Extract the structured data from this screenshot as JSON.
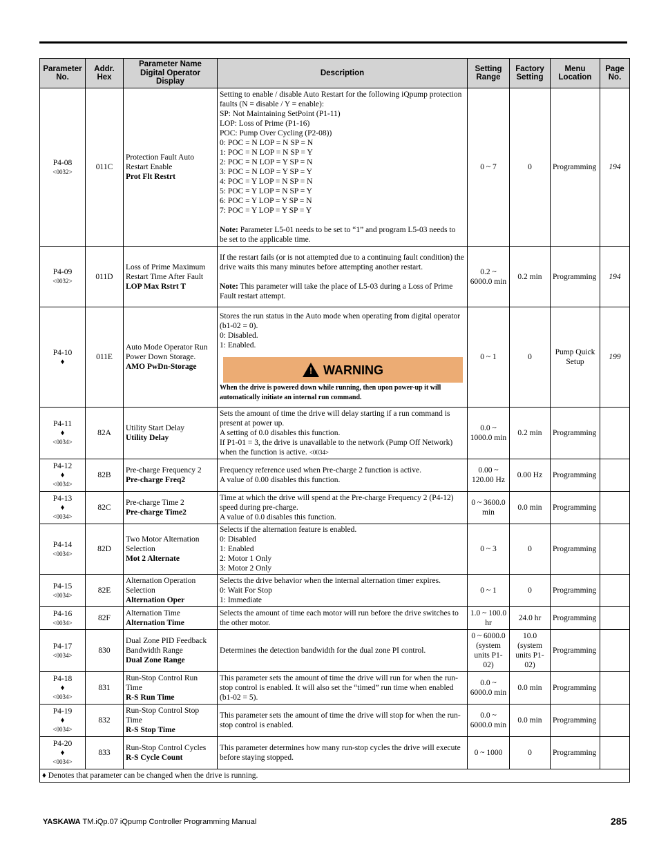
{
  "headers": {
    "param_no": "Parameter No.",
    "addr_hex": "Addr. Hex",
    "name": "Parameter Name Digital Operator Display",
    "description": "Description",
    "setting_range": "Setting Range",
    "factory_setting": "Factory Setting",
    "menu_location": "Menu Location",
    "page_no": "Page No."
  },
  "rows": [
    {
      "param": "P4-08",
      "diamond": "",
      "ref": "<0032>",
      "addr": "011C",
      "name": "Protection Fault Auto Restart Enable",
      "display": "Prot Flt Restrt",
      "desc": [
        "Setting to enable / disable Auto Restart for the following iQpump protection faults (N = disable / Y = enable):",
        "SP: Not Maintaining SetPoint (P1-11)",
        "LOP: Loss of Prime (P1-16)",
        "POC: Pump Over Cycling (P2-08))",
        "0: POC = N LOP = N SP = N",
        "1: POC = N LOP = N SP = Y",
        "2: POC = N LOP = Y SP = N",
        "3: POC = N LOP = Y SP = Y",
        "4: POC = Y LOP = N SP = N",
        "5: POC = Y LOP = N SP = Y",
        "6: POC = Y LOP = Y SP = N",
        "7: POC = Y LOP = Y SP = Y"
      ],
      "note_label": "Note:",
      "note": " Parameter L5-01 needs to be set to “1” and program L5-03 needs to be set to the applicable time.",
      "range": "0 ~ 7",
      "factory": "0",
      "menu": "Programming",
      "page": "194"
    },
    {
      "param": "P4-09",
      "diamond": "",
      "ref": "<0032>",
      "addr": "011D",
      "name": "Loss of Prime Maximum Restart Time After Fault",
      "display": "LOP Max Rstrt T",
      "desc": [
        "If the restart fails (or is not attempted due to a continuing fault condition) the drive waits this many minutes before attempting another restart."
      ],
      "note_label": "Note:",
      "note": " This parameter will take the place of L5-03 during a Loss of Prime Fault restart attempt.",
      "range": "0.2 ~ 6000.0 min",
      "factory": "0.2 min",
      "menu": "Programming",
      "page": "194"
    },
    {
      "param": "P4-10",
      "diamond": "♦",
      "ref": "",
      "addr": "011E",
      "name": "Auto Mode Operator Run Power Down Storage.",
      "display": "AMO PwDn-Storage",
      "desc": [
        "Stores the run status in the Auto mode when operating from digital operator (b1-02 = 0).",
        "0: Disabled.",
        "1: Enabled."
      ],
      "warning_label": "WARNING",
      "warning_text": "When the drive is powered down while running, then upon power-up it will automatically initiate an internal run command.",
      "range": "0 ~ 1",
      "factory": "0",
      "menu": "Pump Quick Setup",
      "page": "199"
    },
    {
      "param": "P4-11",
      "diamond": "♦",
      "ref": "<0034>",
      "addr": "82A",
      "name": "Utility Start Delay",
      "display": "Utility Delay",
      "desc": [
        "Sets the amount of time the drive will delay starting if a run command is present at power up.",
        "A setting of 0.0 disables this function.",
        "If P1-01 = 3, the drive is unavailable to the network (Pump Off Network) when the function is active."
      ],
      "desc_ref": "<0034>",
      "range": "0.0 ~ 1000.0 min",
      "factory": "0.2 min",
      "menu": "Programming",
      "page": ""
    },
    {
      "param": "P4-12",
      "diamond": "♦",
      "ref": "<0034>",
      "addr": "82B",
      "name": "Pre-charge Frequency 2",
      "display": "Pre-charge Freq2",
      "desc": [
        "Frequency reference used when Pre-charge 2 function is active.",
        "A value of 0.00 disables this function."
      ],
      "range": "0.00 ~ 120.00 Hz",
      "factory": "0.00 Hz",
      "menu": "Programming",
      "page": ""
    },
    {
      "param": "P4-13",
      "diamond": "♦",
      "ref": "<0034>",
      "addr": "82C",
      "name": "Pre-charge Time 2",
      "display": "Pre-charge Time2",
      "desc": [
        "Time at which the drive will spend at the Pre-charge Frequency 2 (P4-12) speed during pre-charge.",
        "A value of 0.0 disables this function."
      ],
      "range": "0 ~ 3600.0 min",
      "factory": "0.0 min",
      "menu": "Programming",
      "page": ""
    },
    {
      "param": "P4-14",
      "diamond": "",
      "ref": "<0034>",
      "addr": "82D",
      "name": "Two Motor Alternation Selection",
      "display": "Mot 2 Alternate",
      "desc": [
        "Selects if the alternation feature is enabled.",
        "0: Disabled",
        "1: Enabled",
        "2: Motor 1 Only",
        "3: Motor 2 Only"
      ],
      "range": "0 ~ 3",
      "factory": "0",
      "menu": "Programming",
      "page": ""
    },
    {
      "param": "P4-15",
      "diamond": "",
      "ref": "<0034>",
      "addr": "82E",
      "name": "Alternation Operation Selection",
      "display": "Alternation Oper",
      "desc": [
        "Selects the drive behavior when the internal alternation timer expires.",
        "0: Wait For Stop",
        "1: Immediate"
      ],
      "range": "0 ~ 1",
      "factory": "0",
      "menu": "Programming",
      "page": ""
    },
    {
      "param": "P4-16",
      "diamond": "",
      "ref": "<0034>",
      "addr": "82F",
      "name": "Alternation Time",
      "display": "Alternation Time",
      "desc": [
        "Selects the amount of time each motor will run before the drive switches to the other motor."
      ],
      "range": "1.0 ~ 100.0 hr",
      "factory": "24.0 hr",
      "menu": "Programming",
      "page": ""
    },
    {
      "param": "P4-17",
      "diamond": "",
      "ref": "<0034>",
      "addr": "830",
      "name": "Dual Zone PID Feedback Bandwidth Range",
      "display": "Dual Zone Range",
      "desc": [
        "Determines the detection bandwidth for the dual zone PI control."
      ],
      "range": "0 ~ 6000.0 (system units P1-02)",
      "factory": "10.0 (system units P1-02)",
      "menu": "Programming",
      "page": ""
    },
    {
      "param": "P4-18",
      "diamond": "♦",
      "ref": "<0034>",
      "addr": "831",
      "name": "Run-Stop Control Run Time",
      "display": "R-S Run Time",
      "desc": [
        "This parameter sets the amount of time the drive will run for when the run-stop control is enabled. It will also set the “timed” run time when enabled (b1-02 = 5)."
      ],
      "range": "0.0 ~ 6000.0 min",
      "factory": "0.0 min",
      "menu": "Programming",
      "page": ""
    },
    {
      "param": "P4-19",
      "diamond": "♦",
      "ref": "<0034>",
      "addr": "832",
      "name": "Run-Stop Control Stop Time",
      "display": "R-S Stop Time",
      "desc": [
        "This parameter sets the amount of time the drive will stop for when the run-stop control is enabled."
      ],
      "range": "0.0 ~ 6000.0 min",
      "factory": "0.0 min",
      "menu": "Programming",
      "page": ""
    },
    {
      "param": "P4-20",
      "diamond": "♦",
      "ref": "<0034>",
      "addr": "833",
      "name": "Run-Stop Control Cycles",
      "display": "R-S Cycle Count",
      "desc": [
        "This parameter determines how many run-stop cycles the drive will execute before staying stopped."
      ],
      "range": "0 ~ 1000",
      "factory": "0",
      "menu": "Programming",
      "page": ""
    }
  ],
  "footnote": "♦ Denotes that parameter can be changed when the drive is running.",
  "footer": {
    "brand": "YASKAWA",
    "title": " TM.iQp.07 iQpump Controller Programming Manual",
    "page_number": "285"
  }
}
